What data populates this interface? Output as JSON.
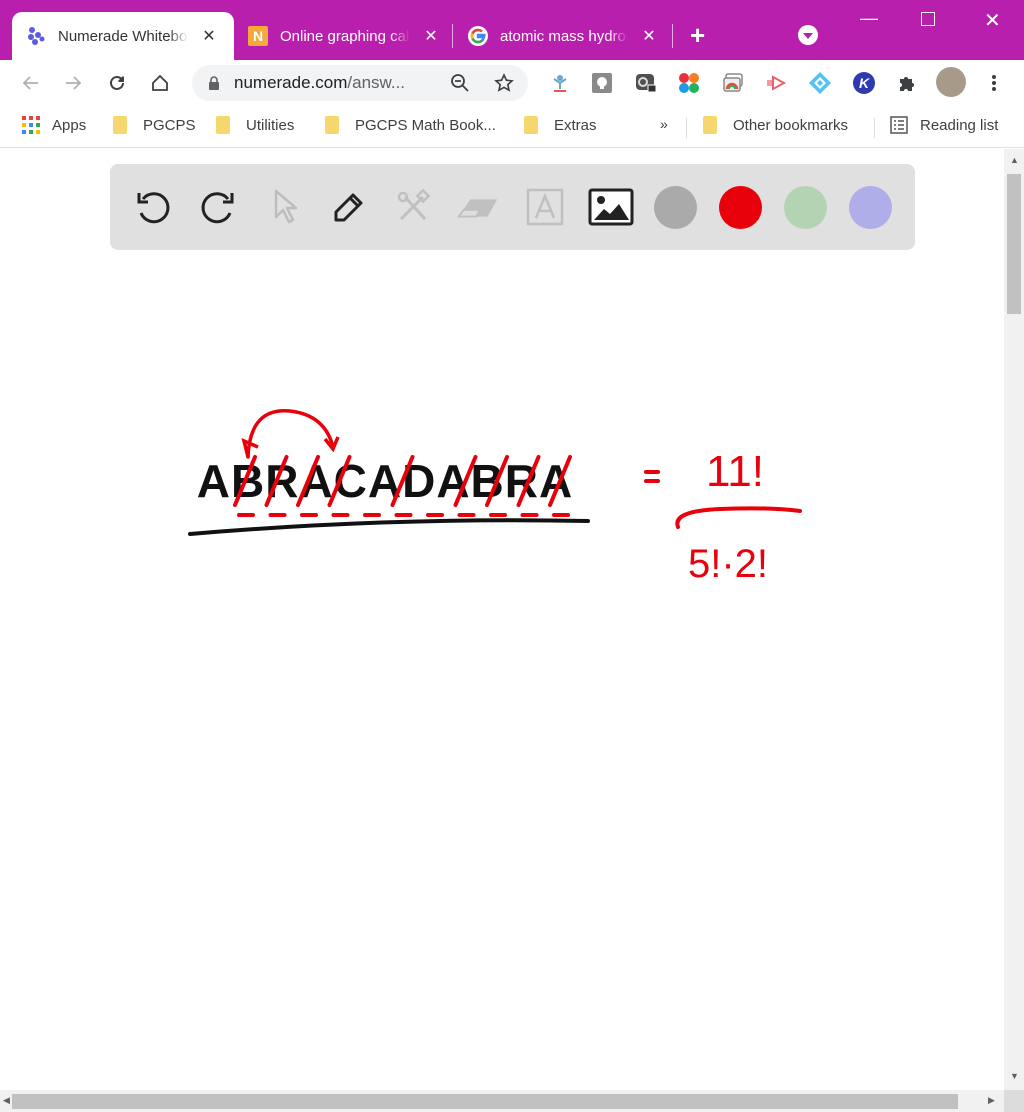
{
  "browser": {
    "tabs": [
      {
        "title": "Numerade Whiteboard",
        "icon": "numerade-icon",
        "active": true
      },
      {
        "title": "Online graphing calculator",
        "icon": "n-icon",
        "active": false
      },
      {
        "title": "atomic mass hydrogen",
        "icon": "google-icon",
        "active": false
      }
    ],
    "new_tab_label": "+",
    "address_bar": {
      "host": "numerade.com",
      "path": "/answ..."
    },
    "extensions": [
      "extension-figure-icon",
      "extension-keep-icon",
      "extension-screen-icon",
      "extension-colors-icon",
      "extension-cast-icon",
      "extension-arrow-icon",
      "extension-diamond-icon",
      "extension-k-icon",
      "puzzle-icon",
      "avatar",
      "more-icon"
    ],
    "bookmarks": [
      {
        "label": "Apps",
        "icon": "apps-icon"
      },
      {
        "label": "PGCPS",
        "icon": "folder-icon"
      },
      {
        "label": "Utilities",
        "icon": "folder-icon"
      },
      {
        "label": "PGCPS Math Book...",
        "icon": "folder-icon"
      },
      {
        "label": "Extras",
        "icon": "folder-icon"
      }
    ],
    "overflow_label": "»",
    "other_bookmarks": "Other bookmarks",
    "reading_list": "Reading list"
  },
  "whiteboard": {
    "tools": [
      {
        "name": "undo",
        "enabled": true
      },
      {
        "name": "redo",
        "enabled": true
      },
      {
        "name": "select",
        "enabled": false
      },
      {
        "name": "pen",
        "enabled": true
      },
      {
        "name": "tools",
        "enabled": false
      },
      {
        "name": "eraser",
        "enabled": false
      },
      {
        "name": "text",
        "enabled": false
      },
      {
        "name": "image",
        "enabled": true
      }
    ],
    "colors": [
      "#aaaaaa",
      "#e8000b",
      "#b3d4b3",
      "#b0aee8"
    ],
    "selected_color": "#e8000b",
    "drawing": {
      "word": "ABRACADABRA",
      "equals": "=",
      "numerator": "11!",
      "denominator": "5!·2!"
    }
  }
}
